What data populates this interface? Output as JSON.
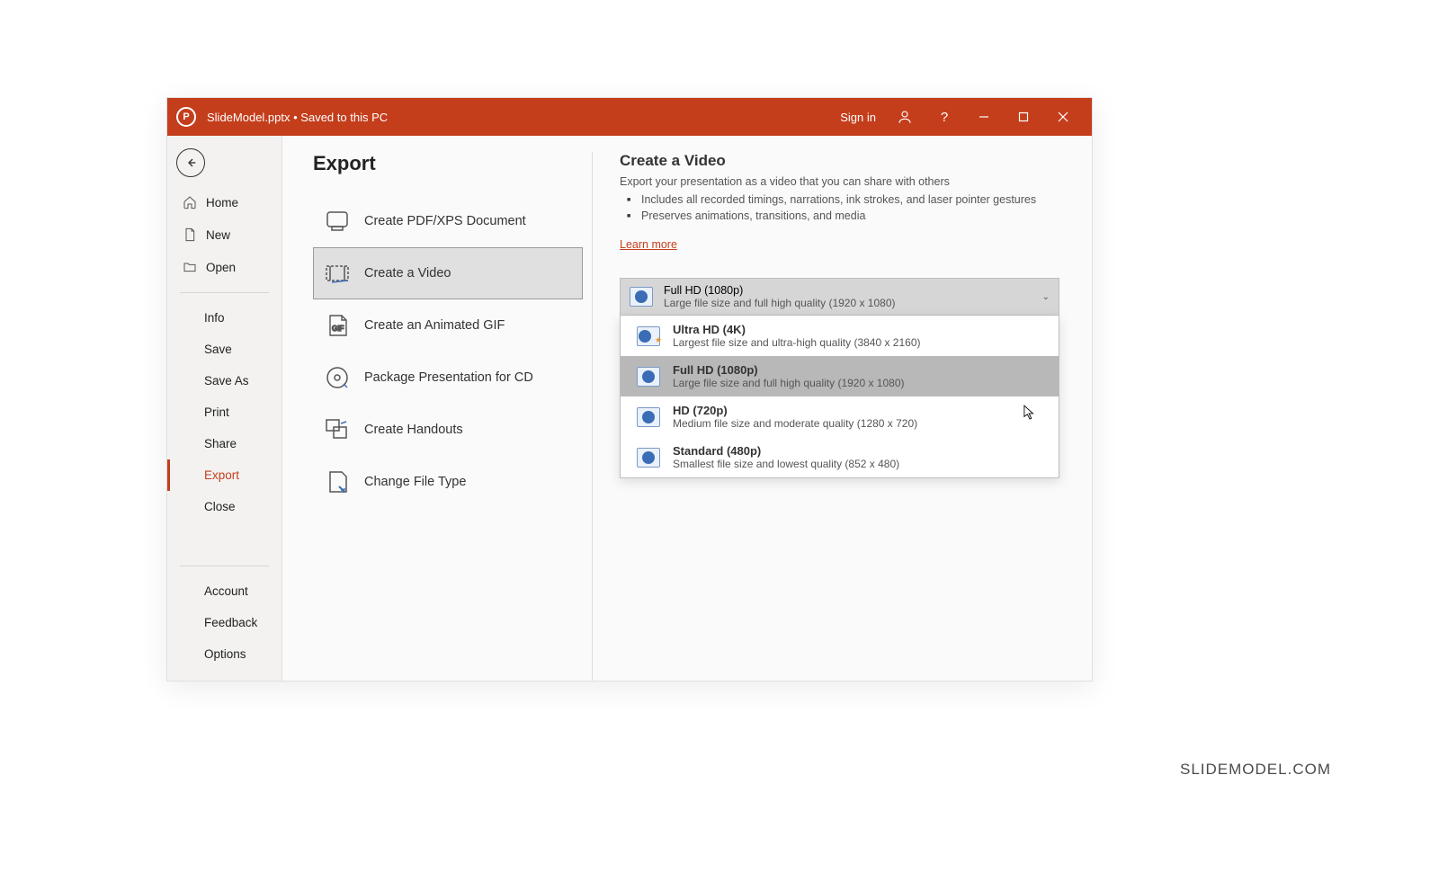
{
  "titlebar": {
    "filename": "SlideModel.pptx",
    "savestatus": "Saved to this PC",
    "signin": "Sign in"
  },
  "sidebar": {
    "home": "Home",
    "new": "New",
    "open": "Open",
    "info": "Info",
    "save": "Save",
    "saveas": "Save As",
    "print": "Print",
    "share": "Share",
    "export": "Export",
    "close": "Close",
    "account": "Account",
    "feedback": "Feedback",
    "options": "Options"
  },
  "main": {
    "title": "Export",
    "options": {
      "pdf": "Create PDF/XPS Document",
      "video": "Create a Video",
      "gif": "Create an Animated GIF",
      "cd": "Package Presentation for CD",
      "handouts": "Create Handouts",
      "filetype": "Change File Type"
    }
  },
  "detail": {
    "heading": "Create a Video",
    "sub": "Export your presentation as a video that you can share with others",
    "bullet1": "Includes all recorded timings, narrations, ink strokes, and laser pointer gestures",
    "bullet2": "Preserves animations, transitions, and media",
    "learnmore": "Learn more"
  },
  "dropdown": {
    "selected": {
      "title": "Full HD (1080p)",
      "desc": "Large file size and full high quality (1920 x 1080)"
    },
    "items": [
      {
        "title": "Ultra HD (4K)",
        "desc": "Largest file size and ultra-high quality (3840 x 2160)"
      },
      {
        "title": "Full HD (1080p)",
        "desc": "Large file size and full high quality (1920 x 1080)"
      },
      {
        "title": "HD (720p)",
        "desc": "Medium file size and moderate quality (1280 x 720)"
      },
      {
        "title": "Standard (480p)",
        "desc": "Smallest file size and lowest quality (852 x 480)"
      }
    ]
  },
  "watermark": "SLIDEMODEL.COM"
}
